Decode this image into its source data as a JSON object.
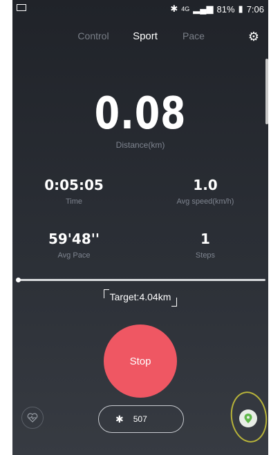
{
  "status": {
    "network": "4G",
    "battery": "81%",
    "time": "7:06",
    "icons": [
      "image-icon",
      "bluetooth-icon",
      "signal-icon",
      "battery-icon"
    ]
  },
  "tabs": [
    {
      "label": "Control",
      "active": false
    },
    {
      "label": "Sport",
      "active": true
    },
    {
      "label": "Pace",
      "active": false
    }
  ],
  "distance": {
    "value": "0.08",
    "label": "Distance(km)"
  },
  "stats": {
    "time": {
      "value": "0:05:05",
      "label": "Time"
    },
    "avg_speed": {
      "value": "1.0",
      "label": "Avg speed(km/h)"
    },
    "avg_pace": {
      "value": "59'48''",
      "label": "Avg Pace"
    },
    "steps": {
      "value": "1",
      "label": "Steps"
    }
  },
  "target": {
    "label": "Target:4.04km",
    "progress_fraction": 0.02
  },
  "stop_label": "Stop",
  "bluetooth": {
    "value": "507"
  },
  "colors": {
    "accent": "#ef5763",
    "background": "#2b2f36",
    "annotation": "#b8b43a",
    "map_pin": "#5fb84a"
  }
}
